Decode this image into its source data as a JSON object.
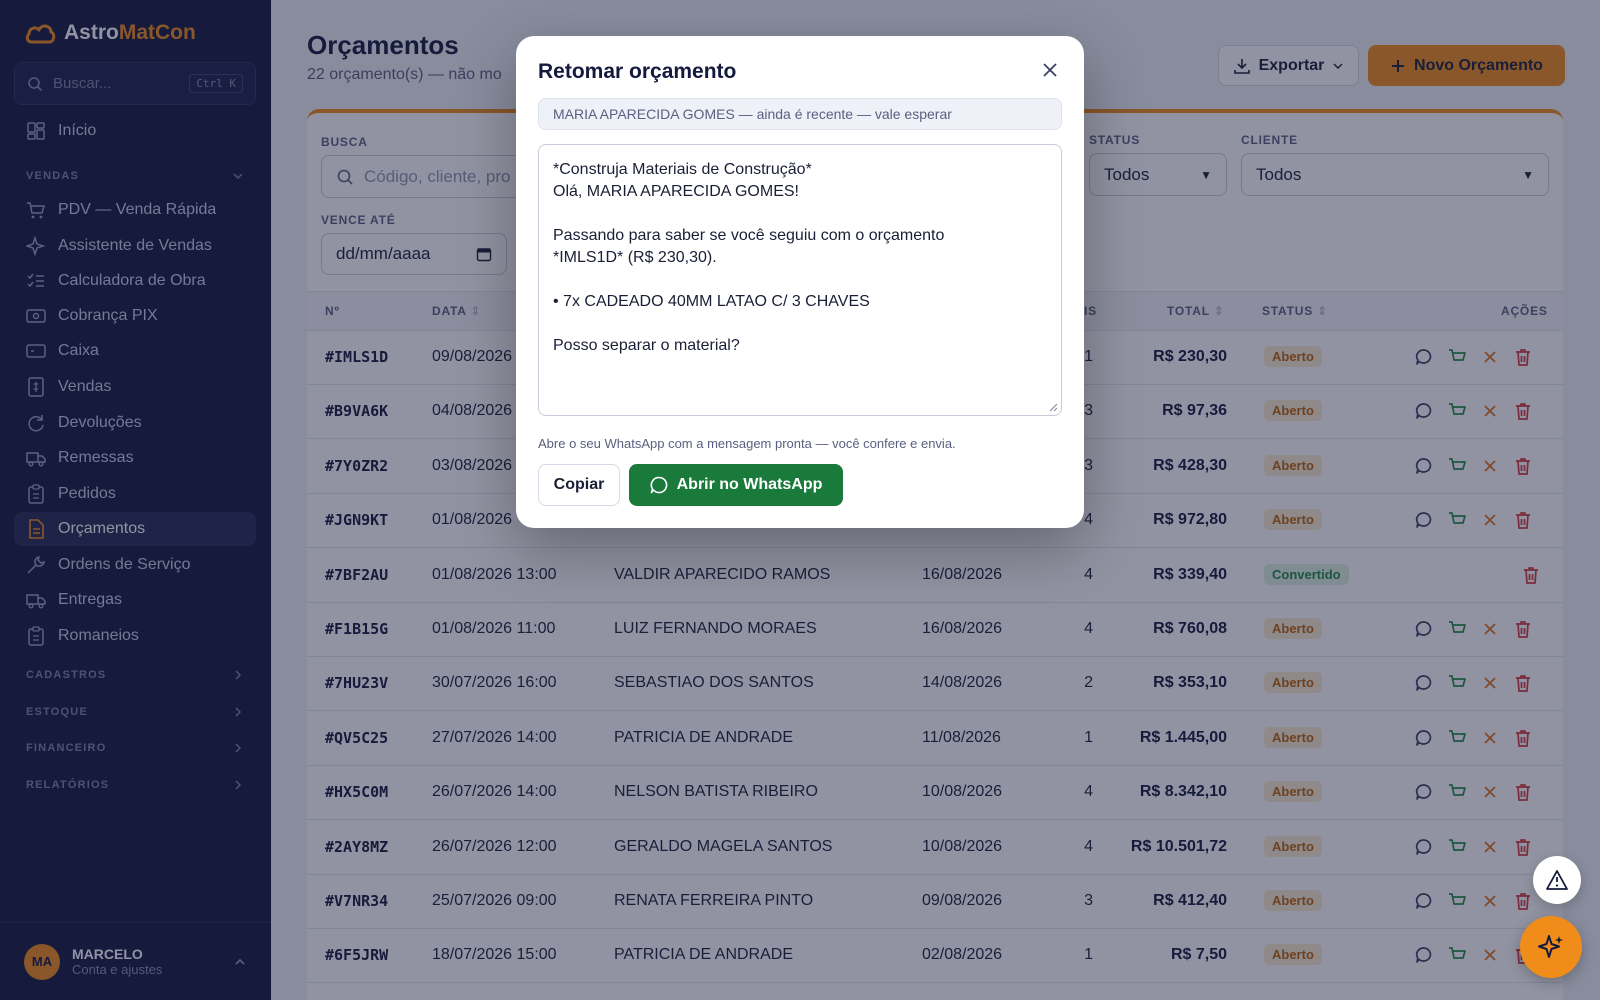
{
  "app": {
    "name_part1": "Astro",
    "name_part2": "MatCon"
  },
  "sidebar": {
    "search_placeholder": "Buscar...",
    "search_shortcut": "Ctrl K",
    "home": "Início",
    "sections": {
      "vendas": "VENDAS",
      "cadastros": "CADASTROS",
      "estoque": "ESTOQUE",
      "financeiro": "FINANCEIRO",
      "relatorios": "RELATÓRIOS"
    },
    "items": [
      {
        "label": "PDV — Venda Rápida",
        "icon": "cart-icon"
      },
      {
        "label": "Assistente de Vendas",
        "icon": "sparkle-icon"
      },
      {
        "label": "Calculadora de Obra",
        "icon": "checklist-icon"
      },
      {
        "label": "Cobrança PIX",
        "icon": "pix-icon"
      },
      {
        "label": "Caixa",
        "icon": "cash-icon"
      },
      {
        "label": "Vendas",
        "icon": "receipt-icon"
      },
      {
        "label": "Devoluções",
        "icon": "return-icon"
      },
      {
        "label": "Remessas",
        "icon": "truck-icon"
      },
      {
        "label": "Pedidos",
        "icon": "clipboard-icon"
      },
      {
        "label": "Orçamentos",
        "icon": "document-icon"
      },
      {
        "label": "Ordens de Serviço",
        "icon": "wrench-icon"
      },
      {
        "label": "Entregas",
        "icon": "truck-icon"
      },
      {
        "label": "Romaneios",
        "icon": "clipboard-icon"
      }
    ],
    "active_item": "Orçamentos",
    "user": {
      "initials": "MA",
      "name": "MARCELO",
      "subtitle": "Conta e ajustes"
    }
  },
  "header": {
    "title": "Orçamentos",
    "subtitle": "22 orçamento(s) — não mo",
    "export_label": "Exportar",
    "new_label": "Novo Orçamento"
  },
  "filters": {
    "busca_label": "BUSCA",
    "busca_placeholder": "Código, cliente, pro",
    "status_label": "STATUS",
    "status_value": "Todos",
    "cliente_label": "CLIENTE",
    "cliente_value": "Todos",
    "vence_label": "VENCE ATÉ",
    "vence_placeholder": "dd/mm/aaaa"
  },
  "table": {
    "columns": {
      "num": "Nº",
      "data": "DATA",
      "itens": "IS",
      "total": "TOTAL",
      "status": "STATUS",
      "acoes": "AÇÕES"
    },
    "rows": [
      {
        "code": "#IMLS1D",
        "date": "09/08/2026",
        "client": "",
        "due": "",
        "items": "1",
        "total": "R$ 230,30",
        "status": "Aberto"
      },
      {
        "code": "#B9VA6K",
        "date": "04/08/2026",
        "client": "",
        "due": "",
        "items": "3",
        "total": "R$ 97,36",
        "status": "Aberto"
      },
      {
        "code": "#7Y0ZR2",
        "date": "03/08/2026",
        "client": "",
        "due": "",
        "items": "3",
        "total": "R$ 428,30",
        "status": "Aberto"
      },
      {
        "code": "#JGN9KT",
        "date": "01/08/2026",
        "client": "",
        "due": "",
        "items": "4",
        "total": "R$ 972,80",
        "status": "Aberto"
      },
      {
        "code": "#7BF2AU",
        "date": "01/08/2026 13:00",
        "client": "VALDIR APARECIDO RAMOS",
        "due": "16/08/2026",
        "items": "4",
        "total": "R$ 339,40",
        "status": "Convertido"
      },
      {
        "code": "#F1B15G",
        "date": "01/08/2026 11:00",
        "client": "LUIZ FERNANDO MORAES",
        "due": "16/08/2026",
        "items": "4",
        "total": "R$ 760,08",
        "status": "Aberto"
      },
      {
        "code": "#7HU23V",
        "date": "30/07/2026 16:00",
        "client": "SEBASTIAO DOS SANTOS",
        "due": "14/08/2026",
        "items": "2",
        "total": "R$ 353,10",
        "status": "Aberto"
      },
      {
        "code": "#QV5C25",
        "date": "27/07/2026 14:00",
        "client": "PATRICIA DE ANDRADE",
        "due": "11/08/2026",
        "items": "1",
        "total": "R$ 1.445,00",
        "status": "Aberto"
      },
      {
        "code": "#HX5C0M",
        "date": "26/07/2026 14:00",
        "client": "NELSON BATISTA RIBEIRO",
        "due": "10/08/2026",
        "items": "4",
        "total": "R$ 8.342,10",
        "status": "Aberto"
      },
      {
        "code": "#2AY8MZ",
        "date": "26/07/2026 12:00",
        "client": "GERALDO MAGELA SANTOS",
        "due": "10/08/2026",
        "items": "4",
        "total": "R$ 10.501,72",
        "status": "Aberto"
      },
      {
        "code": "#V7NR34",
        "date": "25/07/2026 09:00",
        "client": "RENATA FERREIRA PINTO",
        "due": "09/08/2026",
        "items": "3",
        "total": "R$ 412,40",
        "status": "Aberto"
      },
      {
        "code": "#6F5JRW",
        "date": "18/07/2026 15:00",
        "client": "PATRICIA DE ANDRADE",
        "due": "02/08/2026",
        "items": "1",
        "total": "R$ 7,50",
        "status": "Aberto"
      }
    ]
  },
  "modal": {
    "title": "Retomar orçamento",
    "info": "MARIA APARECIDA GOMES — ainda é recente — vale esperar",
    "message_lines": [
      "*Construja Materiais de Construção*",
      "Olá, MARIA APARECIDA GOMES!",
      "",
      "Passando para saber se você seguiu com o orçamento",
      "*IMLS1D* (R$ 230,30).",
      "",
      "• 7x CADEADO 40MM LATAO C/ 3 CHAVES",
      "",
      "Posso separar o material?"
    ],
    "hint": "Abre o seu WhatsApp com a mensagem pronta — você confere e envia.",
    "copy_label": "Copiar",
    "whatsapp_label": "Abrir no WhatsApp"
  },
  "colors": {
    "accent": "#f08c1a",
    "sidebar_bg": "#14193f",
    "whatsapp_green": "#1a7a3c",
    "status_aberto": "#b8650a",
    "status_convertido": "#1f8a45",
    "action_cart": "#1f8a45",
    "action_cancel": "#e0701a",
    "action_delete": "#d33a3a"
  }
}
